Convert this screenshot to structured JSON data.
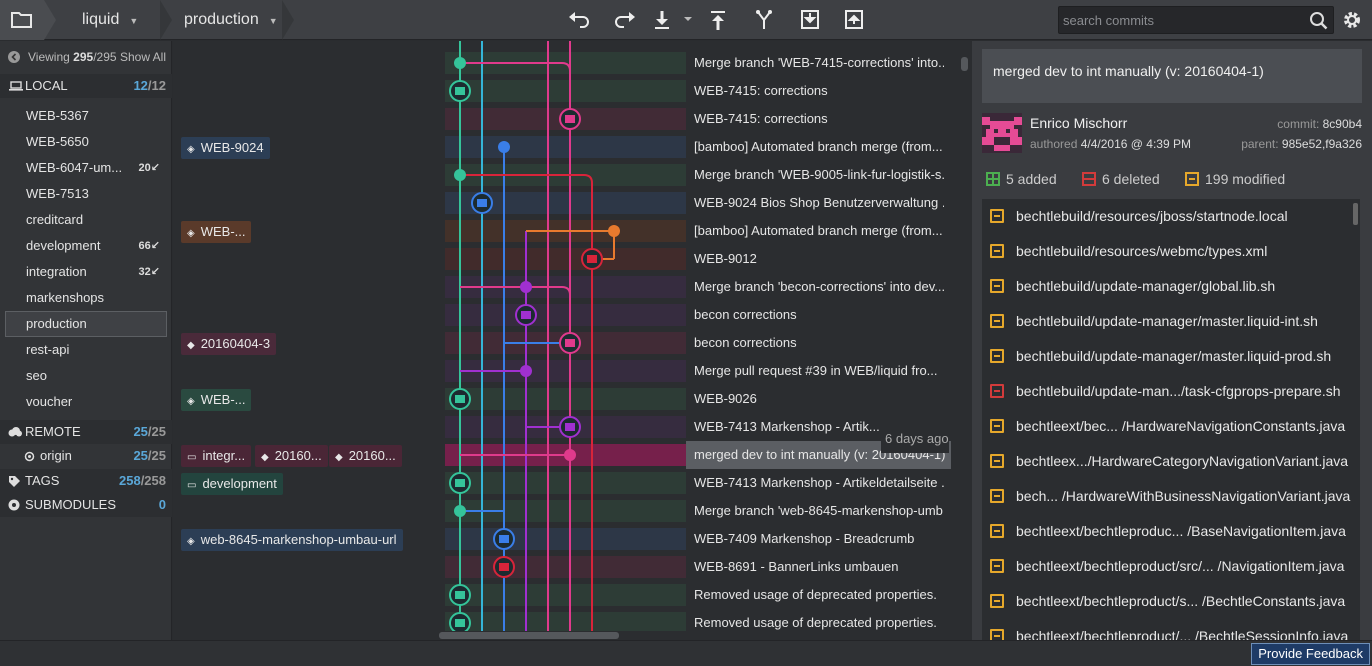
{
  "topbar": {
    "repo": "liquid",
    "branch": "production",
    "search_placeholder": "search commits",
    "tools": [
      "undo-icon",
      "redo-icon",
      "pull-icon",
      "push-icon",
      "branch-icon",
      "stash-icon",
      "pop-icon"
    ]
  },
  "sidebar": {
    "viewing_label": "Viewing",
    "viewing_count": "295",
    "viewing_total": "/295",
    "show_all": "Show All",
    "local": {
      "label": "LOCAL",
      "count": "12",
      "total": "/12"
    },
    "branches": [
      {
        "name": "WEB-5367",
        "count": ""
      },
      {
        "name": "WEB-5650",
        "count": ""
      },
      {
        "name": "WEB-6047-um...",
        "count": "20↙"
      },
      {
        "name": "WEB-7513",
        "count": ""
      },
      {
        "name": "creditcard",
        "count": ""
      },
      {
        "name": "development",
        "count": "66↙"
      },
      {
        "name": "integration",
        "count": "32↙"
      },
      {
        "name": "markenshops",
        "count": ""
      },
      {
        "name": "production",
        "count": ""
      },
      {
        "name": "rest-api",
        "count": ""
      },
      {
        "name": "seo",
        "count": ""
      },
      {
        "name": "voucher",
        "count": ""
      }
    ],
    "remote": {
      "label": "REMOTE",
      "count": "25",
      "total": "/25"
    },
    "origin": {
      "label": "origin",
      "count": "25",
      "total": "/25"
    },
    "tags": {
      "label": "TAGS",
      "count": "258",
      "total": "/258"
    },
    "submodules": {
      "label": "SUBMODULES",
      "count": "0"
    }
  },
  "graph": {
    "messages": [
      "Merge branch 'WEB-7415-corrections' into...",
      "WEB-7415: corrections",
      "WEB-7415: corrections",
      "[bamboo] Automated branch merge (from...",
      "Merge branch 'WEB-9005-link-fur-logistik-s...",
      "WEB-9024 Bios Shop Benutzerverwaltung ...",
      "[bamboo] Automated branch merge (from...",
      "WEB-9012",
      "Merge branch 'becon-corrections' into dev...",
      "becon corrections",
      "becon corrections",
      "Merge pull request #39 in WEB/liquid fro...",
      "WEB-9026",
      "WEB-7413 Markenshop - Artik...",
      "merged dev to int manually (v: 20160404-1)",
      "WEB-7413 Markenshop - Artikeldetailseite ...",
      "Merge branch 'web-8645-markenshop-umb...",
      "WEB-7409 Markenshop - Breadcrumb",
      "WEB-8691 - BannerLinks umbauen",
      "Removed usage of deprecated properties.",
      "Removed usage of deprecated properties."
    ],
    "time_label": "6 days ago",
    "refs": {
      "web9024": "WEB-9024",
      "web_short1": "WEB-...",
      "tag20160404": "20160404-3",
      "web_short2": "WEB-...",
      "integ": "integr...",
      "tag_a": "20160...",
      "tag_b": "20160...",
      "development": "development",
      "web8645": "web-8645-markenshop-umbau-url"
    }
  },
  "detail": {
    "title": "merged dev to int manually (v: 20160404-1)",
    "author": "Enrico Mischorr",
    "authored_label": "authored",
    "authored_date": "4/4/2016 @ 4:39 PM",
    "commit_label": "commit:",
    "commit_sha": "8c90b4",
    "parent_label": "parent:",
    "parent_sha": "985e52,f9a326",
    "added": "5 added",
    "deleted": "6 deleted",
    "modified": "199 modified",
    "files": [
      {
        "path": "bechtlebuild/resources/jboss/startnode.local",
        "status": "modified"
      },
      {
        "path": "bechtlebuild/resources/webmc/types.xml",
        "status": "modified"
      },
      {
        "path": "bechtlebuild/update-manager/global.lib.sh",
        "status": "modified"
      },
      {
        "path": "bechtlebuild/update-manager/master.liquid-int.sh",
        "status": "modified"
      },
      {
        "path": "bechtlebuild/update-manager/master.liquid-prod.sh",
        "status": "modified"
      },
      {
        "path": "bechtlebuild/update-man.../task-cfgprops-prepare.sh",
        "status": "deleted"
      },
      {
        "path": "bechtleext/bec...  /HardwareNavigationConstants.java",
        "status": "modified"
      },
      {
        "path": "bechtleex.../HardwareCategoryNavigationVariant.java",
        "status": "modified"
      },
      {
        "path": "bech...  /HardwareWithBusinessNavigationVariant.java",
        "status": "modified"
      },
      {
        "path": "bechtleext/bechtleproduc...  /BaseNavigationItem.java",
        "status": "modified"
      },
      {
        "path": "bechtleext/bechtleproduct/src/...  /NavigationItem.java",
        "status": "modified"
      },
      {
        "path": "bechtleext/bechtleproduct/s...  /BechtleConstants.java",
        "status": "modified"
      },
      {
        "path": "bechtleext/bechtleproduct/...  /BechtleSessionInfo.java",
        "status": "modified"
      }
    ]
  },
  "statusbar": {
    "feedback": "Provide Feedback"
  },
  "colors": {
    "accent": "#5aa7d8",
    "selected_row": "#c2185b",
    "added": "#4caf50",
    "deleted": "#d23b3b",
    "modified": "#e6a82b"
  }
}
